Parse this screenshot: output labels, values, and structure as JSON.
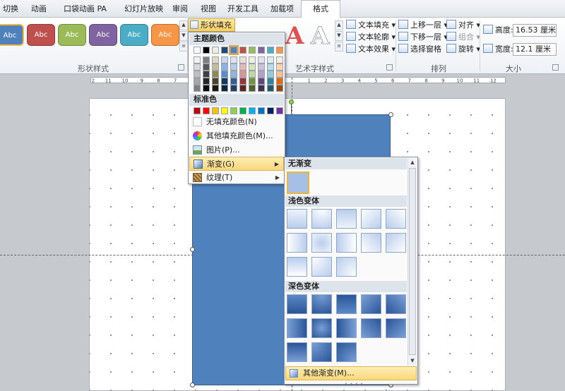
{
  "tabs": [
    "切换",
    "动画",
    "口袋动画 PA",
    "幻灯片放映",
    "审阅",
    "视图",
    "开发工具",
    "加载项",
    "格式"
  ],
  "ribbon": {
    "shape_styles": {
      "label": "形状样式",
      "items": [
        {
          "text": "Abc",
          "color": "#4f81bd"
        },
        {
          "text": "Abc",
          "color": "#c0504d"
        },
        {
          "text": "Abc",
          "color": "#9bbb59"
        },
        {
          "text": "Abc",
          "color": "#8064a2"
        },
        {
          "text": "Abc",
          "color": "#4bacc6"
        },
        {
          "text": "Abc",
          "color": "#f79646"
        }
      ]
    },
    "fill_button": "形状填充",
    "wordart": {
      "label": "艺术字样式",
      "text_fill": "文本填充",
      "text_outline": "文本轮廓",
      "text_effects": "文本效果"
    },
    "arrange": {
      "label": "排列",
      "bring_forward": "上移一层",
      "send_backward": "下移一层",
      "selection_pane": "选择窗格",
      "align": "对齐",
      "group": "组合",
      "rotate": "旋转"
    },
    "size": {
      "label": "大小",
      "height_label": "高度:",
      "height_value": "16.53 厘米",
      "width_label": "宽度:",
      "width_value": "12.1 厘米"
    }
  },
  "ruler": {
    "left_ticks": [
      "12",
      "11",
      "10",
      "9",
      "8",
      "7",
      "6",
      "5",
      "4",
      "3",
      "2",
      "1"
    ],
    "right_ticks": [
      "1",
      "2",
      "3",
      "4",
      "5",
      "6",
      "7",
      "8",
      "9",
      "10",
      "11",
      "12"
    ]
  },
  "fill_menu": {
    "theme_header": "主题颜色",
    "theme_colors": [
      "#ffffff",
      "#000000",
      "#eeece1",
      "#1f497d",
      "#4f81bd",
      "#c0504d",
      "#9bbb59",
      "#8064a2",
      "#4bacc6",
      "#f79646"
    ],
    "theme_shades": [
      [
        "#f2f2f2",
        "#7f7f7f",
        "#ddd9c3",
        "#c6d9f0",
        "#dbe5f1",
        "#f2dcdb",
        "#ebf1dd",
        "#e5e0ec",
        "#dbeef3",
        "#fdeada"
      ],
      [
        "#d8d8d8",
        "#595959",
        "#c4bd97",
        "#8db3e2",
        "#b8cce4",
        "#e5b9b7",
        "#d7e3bc",
        "#ccc1d9",
        "#b7dde8",
        "#fbd5b5"
      ],
      [
        "#bfbfbf",
        "#3f3f3f",
        "#938953",
        "#548dd4",
        "#95b3d7",
        "#d99694",
        "#c3d69b",
        "#b2a2c7",
        "#92cddc",
        "#fac08f"
      ],
      [
        "#a5a5a5",
        "#262626",
        "#494429",
        "#17365d",
        "#366092",
        "#953734",
        "#76923c",
        "#5f497a",
        "#31859b",
        "#e36c09"
      ],
      [
        "#7f7f7f",
        "#0c0c0c",
        "#1d1b10",
        "#0f243e",
        "#244061",
        "#632423",
        "#4f6128",
        "#3f3151",
        "#205867",
        "#974806"
      ]
    ],
    "standard_header": "标准色",
    "standard_colors": [
      "#c00000",
      "#ff0000",
      "#ffc000",
      "#ffff00",
      "#92d050",
      "#00b050",
      "#00b0f0",
      "#0070c0",
      "#002060",
      "#7030a0"
    ],
    "no_fill": "无填充颜色(N)",
    "more_colors": "其他填充颜色(M)...",
    "picture": "图片(P)...",
    "gradient": "渐变(G)",
    "texture": "纹理(T)"
  },
  "gradient_menu": {
    "none_header": "无渐变",
    "light_header": "浅色变体",
    "dark_header": "深色变体",
    "more": "其他渐变(M)..."
  }
}
